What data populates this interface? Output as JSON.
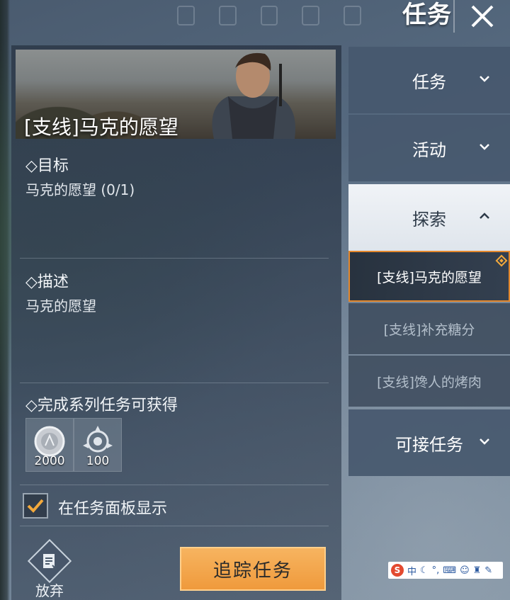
{
  "header": {
    "title": "任务"
  },
  "quest": {
    "title": "[支线]马克的愿望",
    "objective_heading": "◇目标",
    "objective_text": "马克的愿望 (0/1)",
    "description_heading": "◇描述",
    "description_text": "马克的愿望",
    "rewards_heading": "◇完成系列任务可获得",
    "rewards": [
      {
        "icon": "silver-coin-icon",
        "amount": "2000"
      },
      {
        "icon": "rank-badge-icon",
        "amount": "100"
      }
    ],
    "show_on_panel_label": "在任务面板显示",
    "show_on_panel_checked": true,
    "abandon_label": "放弃",
    "track_button_label": "追踪任务"
  },
  "nav": {
    "tabs": [
      {
        "label": "任务",
        "expanded": false
      },
      {
        "label": "活动",
        "expanded": false
      },
      {
        "label": "探索",
        "expanded": true
      },
      {
        "label": "可接任务",
        "expanded": false
      }
    ],
    "explore_items": [
      {
        "label": "[支线]马克的愿望",
        "selected": true
      },
      {
        "label": "[支线]补充糖分",
        "selected": false
      },
      {
        "label": "[支线]馋人的烤肉",
        "selected": false
      }
    ]
  },
  "ime_toolbar": {
    "logo": "S",
    "mode": "中"
  },
  "colors": {
    "accent_orange": "#ef9a3c",
    "selected_border": "#e4882d",
    "panel": "#2c3848"
  }
}
